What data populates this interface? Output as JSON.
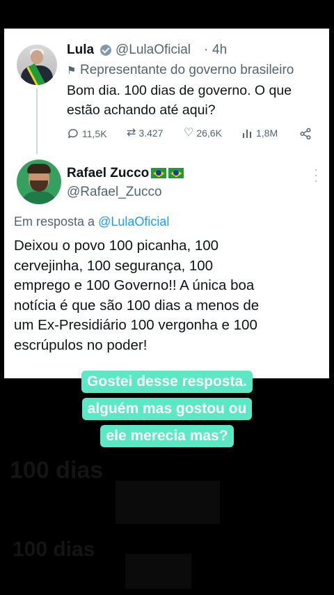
{
  "original_tweet": {
    "display_name": "Lula",
    "handle": "@LulaOficial",
    "separator": "·",
    "time": "4h",
    "label_icon": "flag-icon",
    "label": "Representante do governo brasileiro",
    "text_line1": "Bom dia. 100 dias de governo. O que",
    "text_line2": "estão achando até aqui?",
    "stats": {
      "replies": "11,5K",
      "retweets": "3.427",
      "likes": "26,6K",
      "views": "1,8M"
    }
  },
  "reply_tweet": {
    "display_name": "Rafael Zucco",
    "handle": "@Rafael_Zucco",
    "reply_prefix": "Em resposta a",
    "reply_to": "@LulaOficial",
    "text_lines": [
      "Deixou o povo 100 picanha, 100",
      "cervejinha, 100 segurança, 100",
      "emprego e 100 Governo!! A única boa",
      "notícia é que são 100 dias a menos de",
      "um Ex-Presidiário 100 vergonha e 100",
      "escrúpulos no poder!"
    ]
  },
  "caption": {
    "line1": "Gostei desse resposta.",
    "line2": "alguém mas gostou ou",
    "line3": "ele merecia mas?"
  },
  "background_text": {
    "line1": "100 dias",
    "line2": "100 dias"
  },
  "colors": {
    "caption_bg": "#5ce8c4",
    "link": "#1d9bf0",
    "muted": "#536471"
  }
}
